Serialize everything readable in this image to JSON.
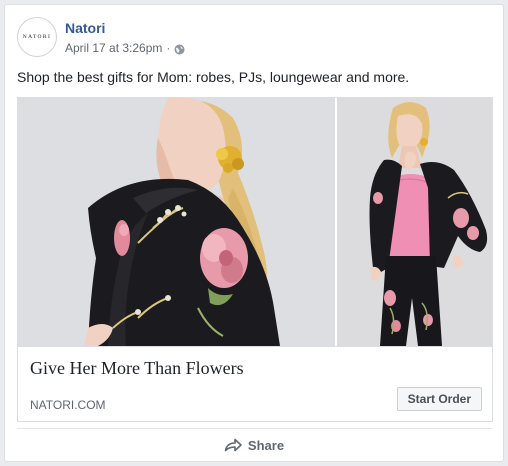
{
  "post": {
    "page_name": "Natori",
    "avatar_text": "NATORI",
    "timestamp": "April 17 at 3:26pm",
    "separator": "·",
    "privacy_icon": "globe-icon",
    "text": "Shop the best gifts for Mom: robes, PJs, loungewear and more."
  },
  "link": {
    "headline": "Give Her More Than Flowers",
    "domain": "NATORI.COM",
    "cta_label": "Start Order"
  },
  "actions": {
    "share_label": "Share",
    "share_icon": "share-arrow-icon"
  },
  "colors": {
    "page_name": "#365899",
    "meta_text": "#616770",
    "robe": "#1b1b1f",
    "flower_pink": "#e79aa9",
    "camisole": "#ee8fb3",
    "earring": "#e0b02e",
    "hair": "#e6c98a"
  }
}
